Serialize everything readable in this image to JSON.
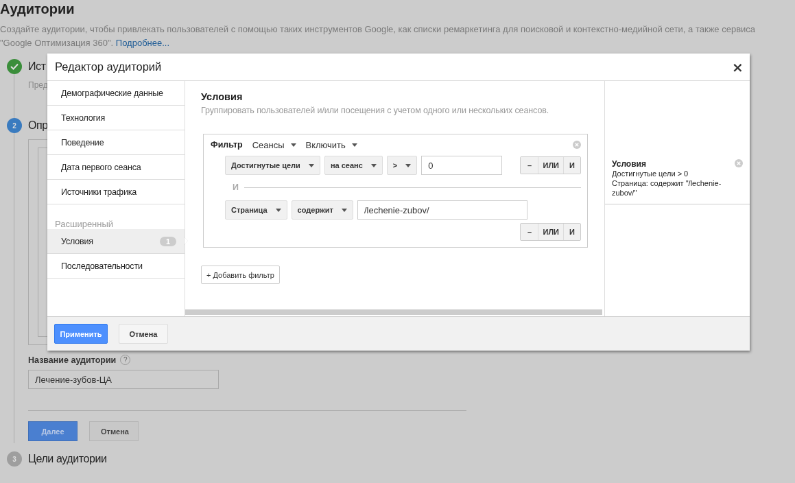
{
  "page": {
    "title": "Аудитории",
    "description": "Создайте аудитории, чтобы привлекать пользователей с помощью таких инструментов Google, как списки ремаркетинга для поисковой и контекстно-медийной сети, а также сервиса \"Google Оптимизация 360\".",
    "more_link": "Подробнее..."
  },
  "steps": [
    {
      "title": "Ист",
      "subtitle": "Пред",
      "kind": "done"
    },
    {
      "number": "2",
      "title": "Опр",
      "kind": "current"
    },
    {
      "number": "3",
      "title": "Цели аудитории",
      "kind": "pending"
    }
  ],
  "audience_name": {
    "label": "Название аудитории",
    "help": "?",
    "value": "Лечение-зубов-ЦА"
  },
  "buttons": [
    {
      "label": "Далее",
      "kind": "primary"
    },
    {
      "label": "Отмена",
      "kind": "secondary"
    }
  ],
  "dialog": {
    "title": "Редактор аудиторий",
    "close": "×",
    "nav_groups": [
      {
        "items": [
          {
            "label": "Демографические данные",
            "selected": false
          },
          {
            "label": "Технология",
            "selected": false
          },
          {
            "label": "Поведение",
            "selected": false
          },
          {
            "label": "Дата первого сеанса",
            "selected": false
          },
          {
            "label": "Источники трафика",
            "selected": false
          }
        ]
      },
      {
        "heading": "Расширенный",
        "items": [
          {
            "label": "Условия",
            "badge": "1",
            "selected": true
          },
          {
            "label": "Последовательности",
            "selected": false
          }
        ]
      }
    ],
    "section": {
      "title": "Условия",
      "subtitle": "Группировать пользователей и/или посещения с учетом одного или нескольких сеансов."
    },
    "filter": {
      "label": "Фильтр",
      "scope": "Сеансы",
      "mode": "Включить",
      "conditions": [
        {
          "fields": [
            "Достигнутые цели",
            "на сеанс",
            ">"
          ],
          "value": "0",
          "buttons": [
            "–",
            "ИЛИ",
            "И"
          ]
        },
        {
          "fields": [
            "Страница",
            "содержит"
          ],
          "value": "/lechenie-zubov/",
          "buttons": [
            "–",
            "ИЛИ",
            "И"
          ]
        }
      ],
      "joiner": "И"
    },
    "add_filter": "+ Добавить фильтр",
    "summary": {
      "title": "Условия",
      "lines": [
        "Достигнутые цели > 0",
        "Страница: содержит \"/lechenie-zubov/\""
      ]
    },
    "buttons": [
      {
        "label": "Применить",
        "kind": "primary"
      },
      {
        "label": "Отмена",
        "kind": "secondary"
      }
    ]
  }
}
